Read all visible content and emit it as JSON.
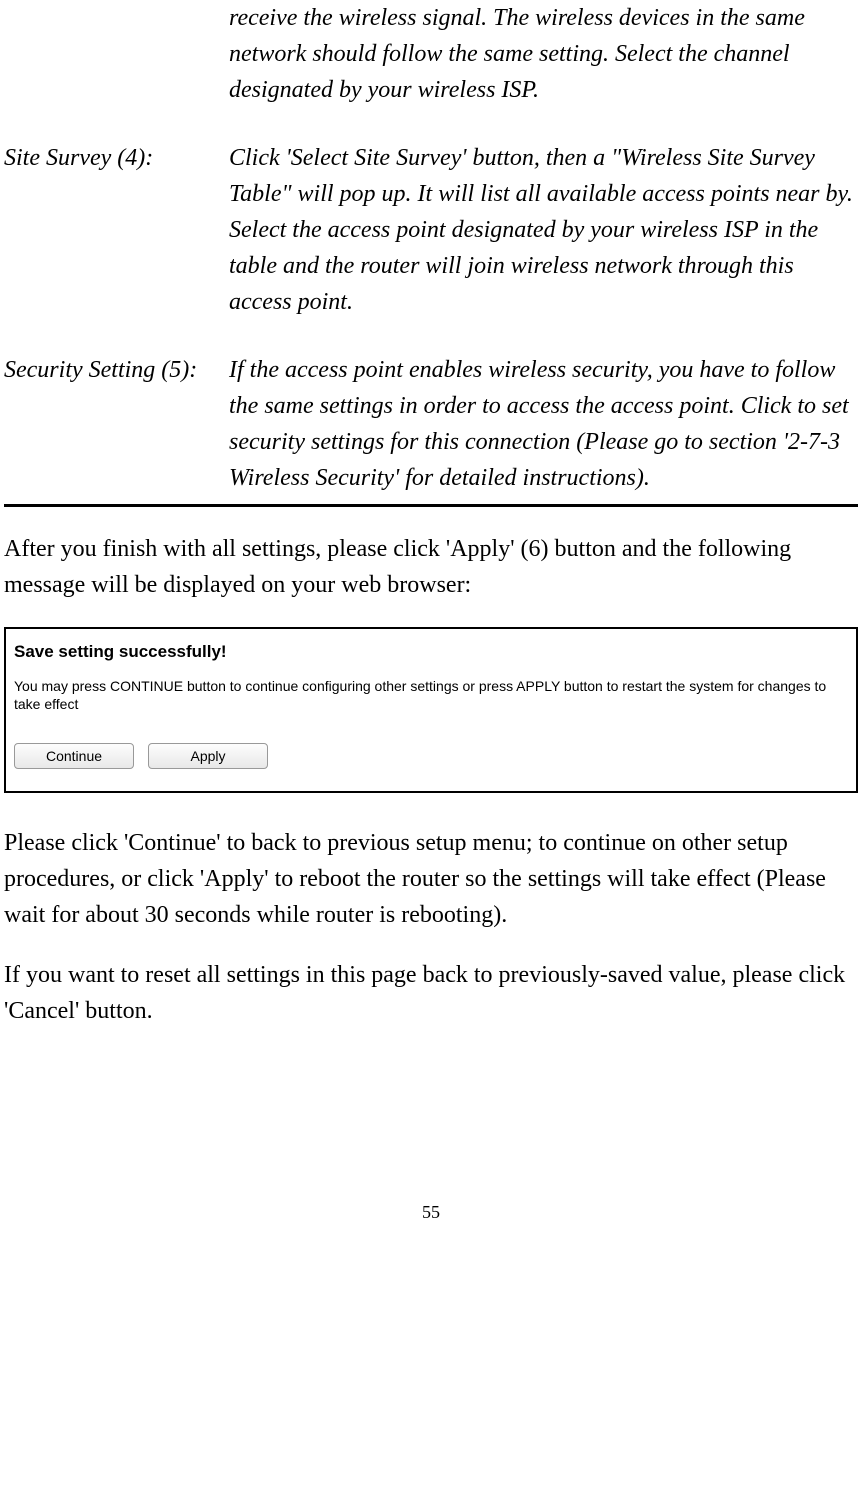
{
  "definitions": {
    "channel_continued": "receive the wireless signal. The wireless devices in the same network should follow the same setting. Select the channel designated by your wireless ISP.",
    "site_survey": {
      "term": "Site Survey (4):",
      "desc": "Click 'Select Site Survey' button, then a \"Wireless Site Survey Table\" will pop up. It will list all available access points near by. Select the access point designated by your wireless ISP in the table and the router will join wireless network through this access point."
    },
    "security_setting": {
      "term": "Security Setting (5):",
      "desc": "If the access point enables wireless security, you have to follow the same settings in order to access the access point. Click to set security settings for this connection   (Please go to section '2-7-3 Wireless Security' for detailed instructions)."
    }
  },
  "body": {
    "after_settings": "After you finish with all settings, please click 'Apply' (6) button and the following message will be displayed on your web browser:",
    "continue_apply": "Please click 'Continue' to back to previous setup menu; to continue on other setup procedures, or click 'Apply' to reboot the router so the settings will take effect (Please wait for about 30 seconds while router is rebooting).",
    "reset_cancel": "If you want to reset all settings in this page back to previously-saved value, please click 'Cancel' button."
  },
  "screenshot": {
    "title": "Save setting successfully!",
    "desc": "You may press CONTINUE button to continue configuring other settings or press APPLY button to restart the system for changes to take effect",
    "continue_label": "Continue",
    "apply_label": "Apply"
  },
  "page_number": "55"
}
